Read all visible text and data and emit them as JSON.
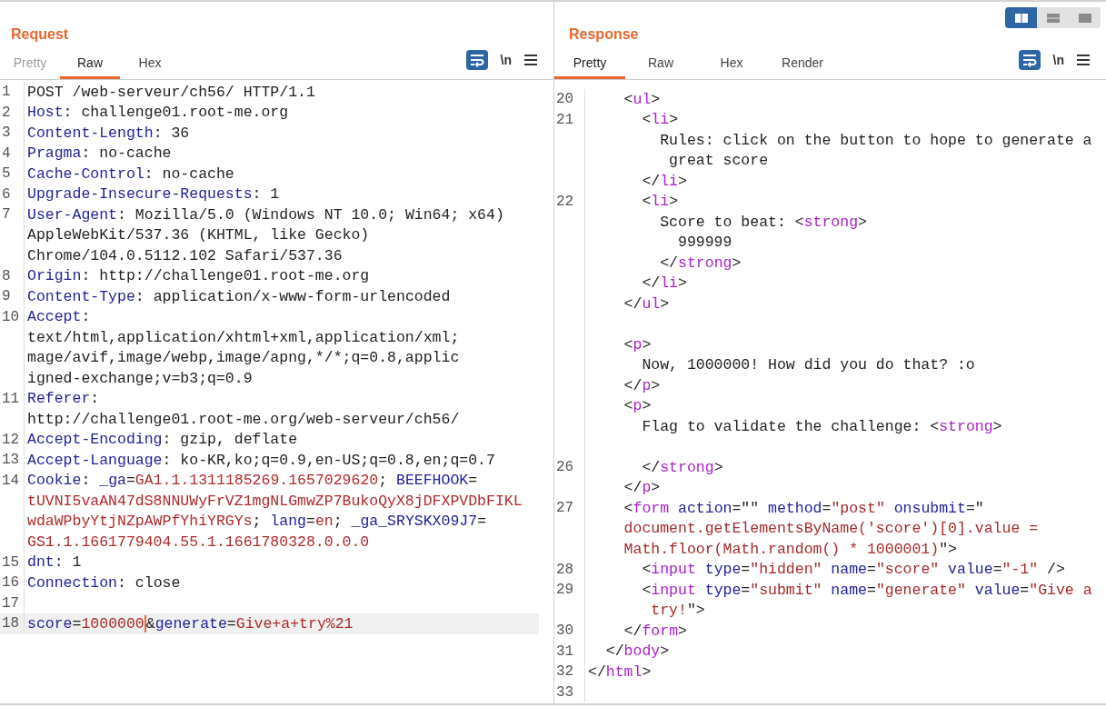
{
  "view_toggle": [
    {
      "selected": true
    },
    {
      "selected": false
    },
    {
      "selected": false
    }
  ],
  "request": {
    "title": "Request",
    "tabs": [
      {
        "label": "Pretty",
        "selected": false,
        "disabled": true
      },
      {
        "label": "Raw",
        "selected": true,
        "disabled": false
      },
      {
        "label": "Hex",
        "selected": false,
        "disabled": false
      }
    ],
    "toolbar": {
      "wrap_on": true,
      "newline_label": "\\n",
      "newline_on": false
    },
    "rows": [
      {
        "number": "1",
        "segments": [
          {
            "kind": "plain",
            "text": "POST /web-serveur/ch56/ HTTP/1.1"
          }
        ]
      },
      {
        "number": "2",
        "segments": [
          {
            "kind": "key",
            "text": "Host"
          },
          {
            "kind": "plain",
            "text": ": challenge01.root-me.org"
          }
        ]
      },
      {
        "number": "3",
        "segments": [
          {
            "kind": "key",
            "text": "Content-Length"
          },
          {
            "kind": "plain",
            "text": ": 36"
          }
        ]
      },
      {
        "number": "4",
        "segments": [
          {
            "kind": "key",
            "text": "Pragma"
          },
          {
            "kind": "plain",
            "text": ": no-cache"
          }
        ]
      },
      {
        "number": "5",
        "segments": [
          {
            "kind": "key",
            "text": "Cache-Control"
          },
          {
            "kind": "plain",
            "text": ": no-cache"
          }
        ]
      },
      {
        "number": "6",
        "segments": [
          {
            "kind": "key",
            "text": "Upgrade-Insecure-Requests"
          },
          {
            "kind": "plain",
            "text": ": 1"
          }
        ]
      },
      {
        "number": "7",
        "segments": [
          {
            "kind": "key",
            "text": "User-Agent"
          },
          {
            "kind": "plain",
            "text": ": Mozilla/5.0 (Windows NT 10.0; Win64; x64)"
          }
        ]
      },
      {
        "segments": [
          {
            "kind": "plain",
            "text": "AppleWebKit/537.36 (KHTML, like Gecko)"
          }
        ]
      },
      {
        "segments": [
          {
            "kind": "plain",
            "text": "Chrome/104.0.5112.102 Safari/537.36"
          }
        ]
      },
      {
        "number": "8",
        "segments": [
          {
            "kind": "key",
            "text": "Origin"
          },
          {
            "kind": "plain",
            "text": ": http://challenge01.root-me.org"
          }
        ]
      },
      {
        "number": "9",
        "segments": [
          {
            "kind": "key",
            "text": "Content-Type"
          },
          {
            "kind": "plain",
            "text": ": application/x-www-form-urlencoded"
          }
        ]
      },
      {
        "number": "10",
        "segments": [
          {
            "kind": "key",
            "text": "Accept"
          },
          {
            "kind": "plain",
            "text": ":"
          }
        ]
      },
      {
        "segments": [
          {
            "kind": "plain",
            "text": "text/html,application/xhtml+xml,application/xml;"
          }
        ]
      },
      {
        "segments": [
          {
            "kind": "plain",
            "text": "mage/avif,image/webp,image/apng,*/*;q=0.8,applic"
          }
        ]
      },
      {
        "segments": [
          {
            "kind": "plain",
            "text": "igned-exchange;v=b3;q=0.9"
          }
        ]
      },
      {
        "number": "11",
        "segments": [
          {
            "kind": "key",
            "text": "Referer"
          },
          {
            "kind": "plain",
            "text": ":"
          }
        ]
      },
      {
        "segments": [
          {
            "kind": "plain",
            "text": "http://challenge01.root-me.org/web-serveur/ch56/"
          }
        ]
      },
      {
        "number": "12",
        "segments": [
          {
            "kind": "key",
            "text": "Accept-Encoding"
          },
          {
            "kind": "plain",
            "text": ": gzip, deflate"
          }
        ]
      },
      {
        "number": "13",
        "segments": [
          {
            "kind": "key",
            "text": "Accept-Language"
          },
          {
            "kind": "plain",
            "text": ": ko-KR,ko;q=0.9,en-US;q=0.8,en;q=0.7"
          }
        ]
      },
      {
        "number": "14",
        "segments": [
          {
            "kind": "key",
            "text": "Cookie"
          },
          {
            "kind": "plain",
            "text": ": "
          },
          {
            "kind": "key",
            "text": "_ga"
          },
          {
            "kind": "plain",
            "text": "="
          },
          {
            "kind": "val",
            "text": "GA1.1.1311185269.1657029620"
          },
          {
            "kind": "plain",
            "text": "; "
          },
          {
            "kind": "key",
            "text": "BEEFHOOK"
          },
          {
            "kind": "plain",
            "text": "="
          }
        ]
      },
      {
        "segments": [
          {
            "kind": "val",
            "text": "tUVNI5vaAN47dS8NNUWyFrVZ1mgNLGmwZP7BukoQyX8jDFXPVDbFIKL"
          }
        ]
      },
      {
        "segments": [
          {
            "kind": "val",
            "text": "wdaWPbyYtjNZpAWPfYhiYRGYs"
          },
          {
            "kind": "plain",
            "text": "; "
          },
          {
            "kind": "key",
            "text": "lang"
          },
          {
            "kind": "plain",
            "text": "="
          },
          {
            "kind": "val",
            "text": "en"
          },
          {
            "kind": "plain",
            "text": "; "
          },
          {
            "kind": "key",
            "text": "_ga_SRYSKX09J7"
          },
          {
            "kind": "plain",
            "text": "="
          }
        ]
      },
      {
        "segments": [
          {
            "kind": "val",
            "text": "GS1.1.1661779404.55.1.1661780328.0.0.0"
          }
        ]
      },
      {
        "number": "15",
        "segments": [
          {
            "kind": "key",
            "text": "dnt"
          },
          {
            "kind": "plain",
            "text": ": 1"
          }
        ]
      },
      {
        "number": "16",
        "segments": [
          {
            "kind": "key",
            "text": "Connection"
          },
          {
            "kind": "plain",
            "text": ": close"
          }
        ]
      },
      {
        "number": "17",
        "segments": []
      },
      {
        "number": "18",
        "highlighted": true,
        "segments": [
          {
            "kind": "key",
            "text": "score"
          },
          {
            "kind": "plain",
            "text": "="
          },
          {
            "kind": "val",
            "text": "1000000"
          },
          {
            "kind": "caret",
            "text": "&"
          },
          {
            "kind": "key",
            "text": "generate"
          },
          {
            "kind": "plain",
            "text": "="
          },
          {
            "kind": "val",
            "text": "Give+a+try%21"
          }
        ]
      }
    ]
  },
  "response": {
    "title": "Response",
    "tabs": [
      {
        "label": "Pretty",
        "selected": true,
        "disabled": false
      },
      {
        "label": "Raw",
        "selected": false,
        "disabled": false
      },
      {
        "label": "Hex",
        "selected": false,
        "disabled": false
      },
      {
        "label": "Render",
        "selected": false,
        "disabled": false
      }
    ],
    "toolbar": {
      "wrap_on": true,
      "newline_label": "\\n",
      "newline_on": false
    },
    "rows": [
      {
        "number": "20",
        "segments": [
          {
            "kind": "plain",
            "text": "    <"
          },
          {
            "kind": "tag",
            "text": "ul"
          },
          {
            "kind": "plain",
            "text": ">"
          }
        ]
      },
      {
        "number": "21",
        "segments": [
          {
            "kind": "plain",
            "text": "      <"
          },
          {
            "kind": "tag",
            "text": "li"
          },
          {
            "kind": "plain",
            "text": ">"
          }
        ]
      },
      {
        "segments": [
          {
            "kind": "plain",
            "text": "        Rules: click on the button to hope to generate a"
          }
        ]
      },
      {
        "segments": [
          {
            "kind": "plain",
            "text": "         great score"
          }
        ]
      },
      {
        "segments": [
          {
            "kind": "plain",
            "text": "      </"
          },
          {
            "kind": "tag",
            "text": "li"
          },
          {
            "kind": "plain",
            "text": ">"
          }
        ]
      },
      {
        "number": "22",
        "segments": [
          {
            "kind": "plain",
            "text": "      <"
          },
          {
            "kind": "tag",
            "text": "li"
          },
          {
            "kind": "plain",
            "text": ">"
          }
        ]
      },
      {
        "segments": [
          {
            "kind": "plain",
            "text": "        Score to beat: <"
          },
          {
            "kind": "tag",
            "text": "strong"
          },
          {
            "kind": "plain",
            "text": ">"
          }
        ]
      },
      {
        "segments": [
          {
            "kind": "plain",
            "text": "          999999"
          }
        ]
      },
      {
        "segments": [
          {
            "kind": "plain",
            "text": "        </"
          },
          {
            "kind": "tag",
            "text": "strong"
          },
          {
            "kind": "plain",
            "text": ">"
          }
        ]
      },
      {
        "segments": [
          {
            "kind": "plain",
            "text": "      </"
          },
          {
            "kind": "tag",
            "text": "li"
          },
          {
            "kind": "plain",
            "text": ">"
          }
        ]
      },
      {
        "segments": [
          {
            "kind": "plain",
            "text": "    </"
          },
          {
            "kind": "tag",
            "text": "ul"
          },
          {
            "kind": "plain",
            "text": ">"
          }
        ]
      },
      {
        "segments": []
      },
      {
        "segments": [
          {
            "kind": "plain",
            "text": "    <"
          },
          {
            "kind": "tag",
            "text": "p"
          },
          {
            "kind": "plain",
            "text": ">"
          }
        ]
      },
      {
        "segments": [
          {
            "kind": "plain",
            "text": "      Now, 1000000! How did you do that? :o"
          }
        ]
      },
      {
        "segments": [
          {
            "kind": "plain",
            "text": "    </"
          },
          {
            "kind": "tag",
            "text": "p"
          },
          {
            "kind": "plain",
            "text": ">"
          }
        ]
      },
      {
        "segments": [
          {
            "kind": "plain",
            "text": "    <"
          },
          {
            "kind": "tag",
            "text": "p"
          },
          {
            "kind": "plain",
            "text": ">"
          }
        ]
      },
      {
        "segments": [
          {
            "kind": "plain",
            "text": "      Flag to validate the challenge: <"
          },
          {
            "kind": "tag",
            "text": "strong"
          },
          {
            "kind": "plain",
            "text": ">"
          }
        ]
      },
      {
        "segments": []
      },
      {
        "number": "26",
        "segments": [
          {
            "kind": "plain",
            "text": "      </"
          },
          {
            "kind": "tag",
            "text": "strong"
          },
          {
            "kind": "plain",
            "text": ">"
          }
        ]
      },
      {
        "segments": [
          {
            "kind": "plain",
            "text": "    </"
          },
          {
            "kind": "tag",
            "text": "p"
          },
          {
            "kind": "plain",
            "text": ">"
          }
        ]
      },
      {
        "number": "27",
        "segments": [
          {
            "kind": "plain",
            "text": "    <"
          },
          {
            "kind": "tag",
            "text": "form"
          },
          {
            "kind": "attr",
            "text": " action"
          },
          {
            "kind": "plain",
            "text": "=\"\" "
          },
          {
            "kind": "attr",
            "text": "method"
          },
          {
            "kind": "plain",
            "text": "="
          },
          {
            "kind": "str",
            "text": "\"post\""
          },
          {
            "kind": "attr",
            "text": " onsubmit"
          },
          {
            "kind": "plain",
            "text": "=\""
          }
        ]
      },
      {
        "segments": [
          {
            "kind": "str",
            "text": "    document.getElementsByName('score')[0].value ="
          }
        ]
      },
      {
        "segments": [
          {
            "kind": "str",
            "text": "    Math.floor(Math.random() * 1000001)"
          },
          {
            "kind": "plain",
            "text": "\">"
          }
        ]
      },
      {
        "number": "28",
        "segments": [
          {
            "kind": "plain",
            "text": "      <"
          },
          {
            "kind": "tag",
            "text": "input"
          },
          {
            "kind": "attr",
            "text": " type"
          },
          {
            "kind": "plain",
            "text": "="
          },
          {
            "kind": "str",
            "text": "\"hidden\""
          },
          {
            "kind": "attr",
            "text": " name"
          },
          {
            "kind": "plain",
            "text": "="
          },
          {
            "kind": "str",
            "text": "\"score\""
          },
          {
            "kind": "attr",
            "text": " value"
          },
          {
            "kind": "plain",
            "text": "="
          },
          {
            "kind": "str",
            "text": "\"-1\""
          },
          {
            "kind": "plain",
            "text": " />"
          }
        ]
      },
      {
        "number": "29",
        "segments": [
          {
            "kind": "plain",
            "text": "      <"
          },
          {
            "kind": "tag",
            "text": "input"
          },
          {
            "kind": "attr",
            "text": " type"
          },
          {
            "kind": "plain",
            "text": "="
          },
          {
            "kind": "str",
            "text": "\"submit\""
          },
          {
            "kind": "attr",
            "text": " name"
          },
          {
            "kind": "plain",
            "text": "="
          },
          {
            "kind": "str",
            "text": "\"generate\""
          },
          {
            "kind": "attr",
            "text": " value"
          },
          {
            "kind": "plain",
            "text": "="
          },
          {
            "kind": "str",
            "text": "\"Give a"
          }
        ]
      },
      {
        "segments": [
          {
            "kind": "str",
            "text": "       try!"
          },
          {
            "kind": "plain",
            "text": "\">"
          }
        ]
      },
      {
        "number": "30",
        "segments": [
          {
            "kind": "plain",
            "text": "    </"
          },
          {
            "kind": "tag",
            "text": "form"
          },
          {
            "kind": "plain",
            "text": ">"
          }
        ]
      },
      {
        "number": "31",
        "segments": [
          {
            "kind": "plain",
            "text": "  </"
          },
          {
            "kind": "tag",
            "text": "body"
          },
          {
            "kind": "plain",
            "text": ">"
          }
        ]
      },
      {
        "number": "32",
        "segments": [
          {
            "kind": "plain",
            "text": "</"
          },
          {
            "kind": "tag",
            "text": "html"
          },
          {
            "kind": "plain",
            "text": ">"
          }
        ]
      },
      {
        "number": "33",
        "segments": []
      }
    ]
  }
}
